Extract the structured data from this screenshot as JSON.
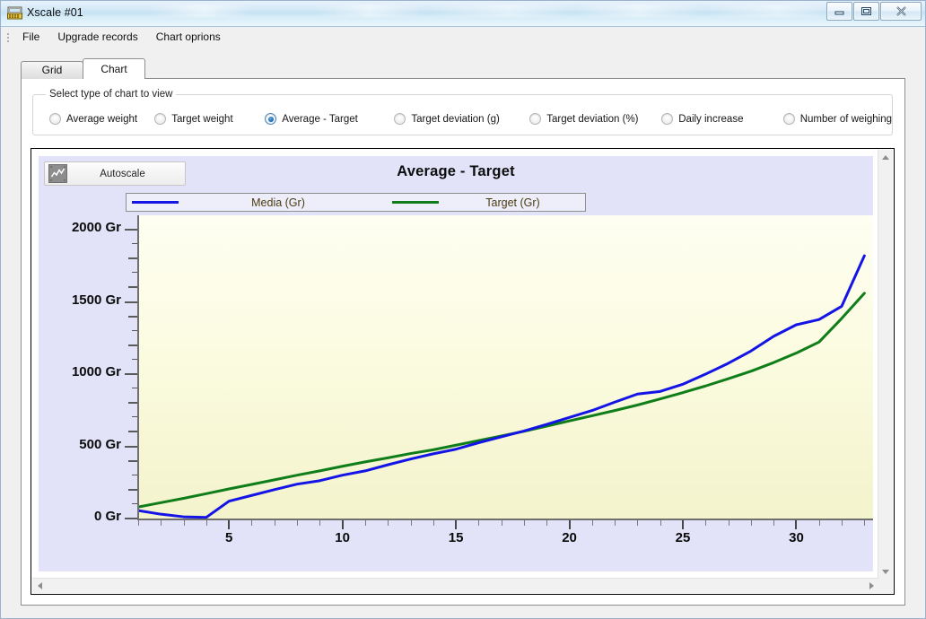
{
  "window": {
    "title": "Xscale #01",
    "icon": "weighing-scale-icon",
    "caption_buttons": [
      {
        "name": "minimize",
        "glyph": "minimize-icon"
      },
      {
        "name": "maximize",
        "glyph": "maximize-icon"
      },
      {
        "name": "close",
        "glyph": "close-icon"
      }
    ]
  },
  "menu": {
    "items": [
      {
        "label": "File"
      },
      {
        "label": "Upgrade records"
      },
      {
        "label": "Chart oprions"
      }
    ]
  },
  "tabs": [
    {
      "label": "Grid",
      "active": false
    },
    {
      "label": "Chart",
      "active": true
    }
  ],
  "chart_type_group": {
    "legend": "Select type of chart to view",
    "options": [
      {
        "label": "Average weight",
        "checked": false
      },
      {
        "label": "Target weight",
        "checked": false
      },
      {
        "label": "Average - Target",
        "checked": true
      },
      {
        "label": "Target deviation (g)",
        "checked": false
      },
      {
        "label": "Target deviation (%)",
        "checked": false
      },
      {
        "label": "Daily increase",
        "checked": false
      },
      {
        "label": "Number of weighing",
        "checked": false
      }
    ]
  },
  "toolbar": {
    "autoscale_label": "Autoscale",
    "autoscale_icon": "line-chart-icon"
  },
  "colors": {
    "series_media": "#1414e6",
    "series_target": "#0f7d19",
    "plot_background_top": "#fefef2",
    "plot_background_bottom": "#f3f3cc",
    "canvas_background": "#e2e2f8",
    "legend_background": "#eeeefb",
    "legend_text": "#4a3b10",
    "accent": "#1f6eb4"
  },
  "chart_data": {
    "type": "line",
    "title": "Average - Target",
    "xlabel": "",
    "ylabel": "",
    "grid": false,
    "legend_position": "top",
    "xlim": [
      1,
      33.5
    ],
    "ylim": [
      0,
      2100
    ],
    "x_ticks_major": [
      5,
      10,
      15,
      20,
      25,
      30
    ],
    "x_tick_labels": [
      "5",
      "10",
      "15",
      "20",
      "25",
      "30"
    ],
    "x_ticks_minor_step": 1,
    "y_ticks_major": [
      0,
      500,
      1000,
      1500,
      2000
    ],
    "y_tick_labels": [
      "0 Gr",
      "500 Gr",
      "1000 Gr",
      "1500 Gr",
      "2000 Gr"
    ],
    "y_ticks_minor_step": 100,
    "y_unit": "Gr",
    "x": [
      1,
      2,
      3,
      4,
      5,
      6,
      7,
      8,
      9,
      10,
      11,
      12,
      13,
      14,
      15,
      16,
      17,
      18,
      19,
      20,
      21,
      22,
      23,
      24,
      25,
      26,
      27,
      28,
      29,
      30,
      31,
      32,
      33
    ],
    "series": [
      {
        "name": "Media  (Gr)",
        "color": "#1414e6",
        "values": [
          55,
          30,
          12,
          8,
          120,
          160,
          200,
          238,
          262,
          300,
          330,
          372,
          412,
          448,
          480,
          525,
          566,
          606,
          652,
          700,
          748,
          806,
          862,
          880,
          930,
          1000,
          1075,
          1160,
          1262,
          1342,
          1378,
          1470,
          1820
        ]
      },
      {
        "name": "Target  (Gr)",
        "color": "#0f7d19",
        "values": [
          80,
          110,
          140,
          172,
          205,
          236,
          268,
          300,
          330,
          362,
          392,
          420,
          450,
          476,
          508,
          540,
          572,
          604,
          640,
          676,
          712,
          748,
          786,
          828,
          872,
          918,
          968,
          1020,
          1080,
          1146,
          1222,
          1386,
          1560
        ]
      }
    ]
  }
}
